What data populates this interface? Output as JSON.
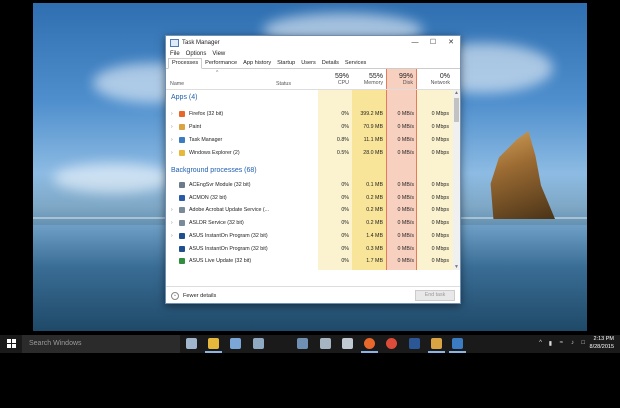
{
  "window": {
    "title": "Task Manager",
    "controls": [
      "—",
      "☐",
      "✕"
    ]
  },
  "menu": [
    "File",
    "Options",
    "View"
  ],
  "tabs": [
    "Processes",
    "Performance",
    "App history",
    "Startup",
    "Users",
    "Details",
    "Services"
  ],
  "columns": {
    "name": "Name",
    "status": "Status",
    "cpu": {
      "pct": "59%",
      "label": "CPU"
    },
    "memory": {
      "pct": "55%",
      "label": "Memory"
    },
    "disk": {
      "pct": "99%",
      "label": "Disk"
    },
    "network": {
      "pct": "0%",
      "label": "Network"
    }
  },
  "groups": {
    "apps": "Apps (4)",
    "background": "Background processes (68)"
  },
  "apps": [
    {
      "name": "Firefox (32 bit)",
      "cpu": "0%",
      "memory": "399.2 MB",
      "disk": "0 MB/s",
      "network": "0 Mbps",
      "icon": "#e8672a"
    },
    {
      "name": "Paint",
      "cpu": "0%",
      "memory": "70.9 MB",
      "disk": "0 MB/s",
      "network": "0 Mbps",
      "icon": "#d9a441"
    },
    {
      "name": "Task Manager",
      "cpu": "0.8%",
      "memory": "11.1 MB",
      "disk": "0 MB/s",
      "network": "0 Mbps",
      "icon": "#3b7bc2"
    },
    {
      "name": "Windows Explorer (2)",
      "cpu": "0.5%",
      "memory": "28.0 MB",
      "disk": "0 MB/s",
      "network": "0 Mbps",
      "icon": "#e6b93c"
    }
  ],
  "background": [
    {
      "name": "ACEngSvr Module (32 bit)",
      "cpu": "0%",
      "memory": "0.1 MB",
      "disk": "0 MB/s",
      "network": "0 Mbps",
      "icon": "#6b7b8c"
    },
    {
      "name": "ACMON (32 bit)",
      "cpu": "0%",
      "memory": "0.2 MB",
      "disk": "0 MB/s",
      "network": "0 Mbps",
      "icon": "#2a5aa8"
    },
    {
      "name": "Adobe Acrobat Update Service (...",
      "cpu": "0%",
      "memory": "0.2 MB",
      "disk": "0 MB/s",
      "network": "0 Mbps",
      "icon": "#7b8a99"
    },
    {
      "name": "ASLDR Service (32 bit)",
      "cpu": "0%",
      "memory": "0.2 MB",
      "disk": "0 MB/s",
      "network": "0 Mbps",
      "icon": "#7b8a99"
    },
    {
      "name": "ASUS InstantOn Program (32 bit)",
      "cpu": "0%",
      "memory": "1.4 MB",
      "disk": "0 MB/s",
      "network": "0 Mbps",
      "icon": "#1f4f8f"
    },
    {
      "name": "ASUS InstantOn Program (32 bit)",
      "cpu": "0%",
      "memory": "0.3 MB",
      "disk": "0 MB/s",
      "network": "0 Mbps",
      "icon": "#1f4f8f"
    },
    {
      "name": "ASUS Live Update (32 bit)",
      "cpu": "0%",
      "memory": "1.7 MB",
      "disk": "0 MB/s",
      "network": "0 Mbps",
      "icon": "#2f8f3f"
    },
    {
      "name": "ASUS Smart Gesture Center",
      "cpu": "0%",
      "memory": "0.6 MB",
      "disk": "0 MB/s",
      "network": "0 Mbps",
      "icon": "#7b8a99"
    }
  ],
  "footer": {
    "fewer_details": "Fewer details",
    "end_task": "End task"
  },
  "colors": {
    "cpu_shade": "#fbf3cf",
    "memory_shade": "#f9e59a",
    "disk_shade": "#f8d0c0",
    "disk_border": "#e57a5c",
    "network_shade": "#fbf3cf",
    "row_highlight": "#f5df80"
  },
  "taskbar": {
    "search_placeholder": "Search Windows",
    "time": "2:13 PM",
    "date": "8/28/2015",
    "icons": [
      "task-view-icon",
      "file-explorer-icon",
      "store-icon",
      "network-app-icon",
      "3d-app-icon",
      "calculator-icon",
      "app-icon",
      "firefox-icon",
      "chrome-icon",
      "word-icon",
      "paint-icon",
      "task-manager-icon"
    ]
  }
}
